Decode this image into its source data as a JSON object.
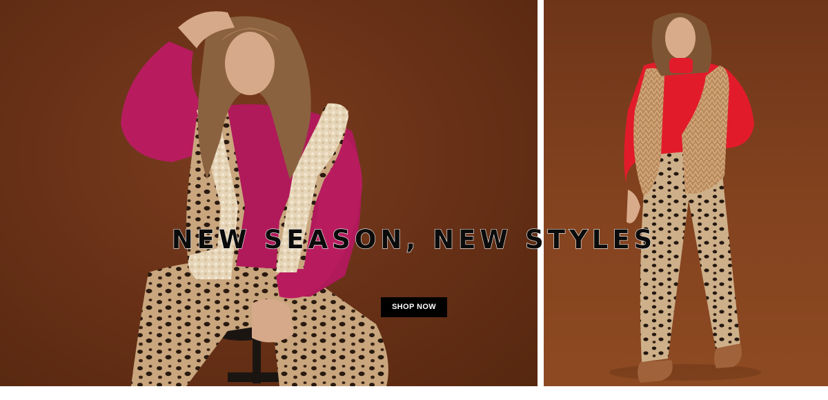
{
  "banner": {
    "headline": "NEW SEASON, NEW STYLES",
    "cta_label": "SHOP NOW"
  },
  "colors": {
    "backdrop": "#6a3218",
    "headline": "#0b0b0b",
    "button_bg": "#000000",
    "button_text": "#ffffff"
  }
}
